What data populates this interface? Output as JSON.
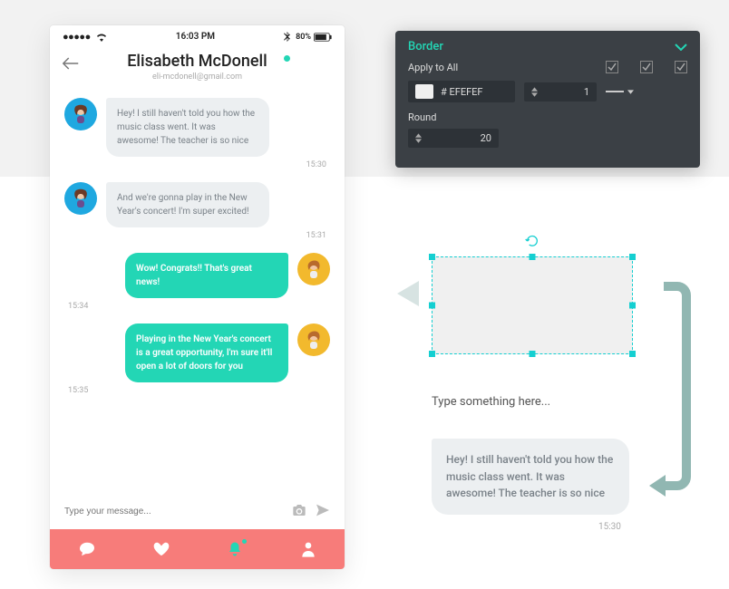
{
  "status": {
    "time": "16:03 PM",
    "battery_pct": "80%"
  },
  "header": {
    "name": "Elisabeth McDonell",
    "email": "eli-mcdonell@gmail.com"
  },
  "messages": [
    {
      "side": "left",
      "text": "Hey! I still haven't told you how the music class went. It was awesome! The teacher is so nice",
      "time": "15:30"
    },
    {
      "side": "left",
      "text": "And we're gonna play in the New Year's concert! I'm super excited!",
      "time": "15:31"
    },
    {
      "side": "right",
      "text": "Wow! Congrats!! That's great news!",
      "time": "15:34"
    },
    {
      "side": "right",
      "text": "Playing in the New Year's concert is a great opportunity, I'm sure it'll open a lot of doors for you",
      "time": "15:35"
    }
  ],
  "composer": {
    "placeholder": "Type your message..."
  },
  "panel": {
    "title": "Border",
    "apply_label": "Apply to All",
    "color": "# EFEFEF",
    "width": "1",
    "round_label": "Round",
    "round": "20"
  },
  "canvas": {
    "type_prompt": "Type something here...",
    "result_text": "Hey! I still haven't told you how the music class went. It was awesome! The teacher is so nice",
    "result_time": "15:30"
  }
}
